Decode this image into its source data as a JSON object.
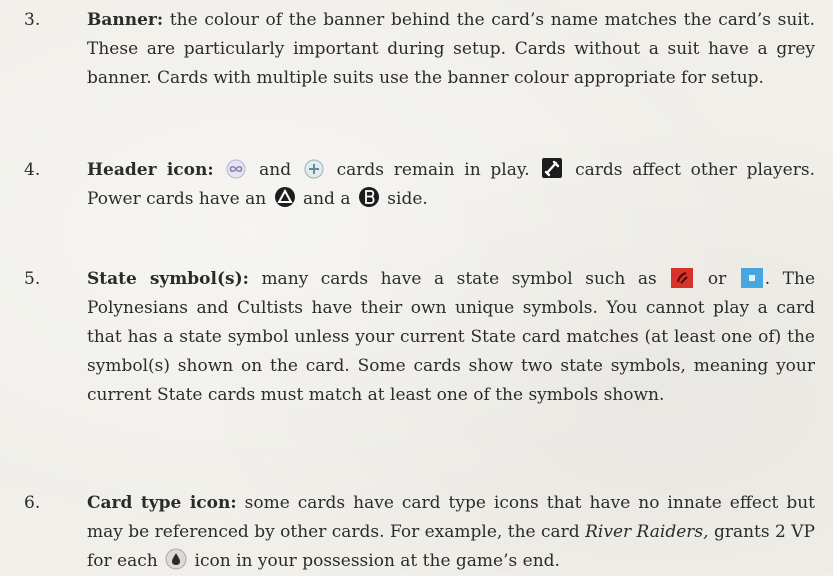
{
  "items": [
    {
      "number": "3.",
      "term": "Banner:",
      "text": "the colour of the banner behind the card’s name matches the card’s suit. These are particularly important during setup. Cards without a suit have a grey banner. Cards with multiple suits use the banner colour appropriate for setup."
    },
    {
      "number": "4.",
      "term": "Header icon:",
      "seg1": "and",
      "seg2": "cards remain in play.",
      "seg3": "cards affect other players. Power cards have an",
      "seg4": "and a",
      "seg5": "side.",
      "icons": [
        "infinity-icon",
        "plus-circle-icon",
        "attack-icon",
        "power-a-icon",
        "power-b-icon"
      ]
    },
    {
      "number": "5.",
      "term": "State symbol(s):",
      "seg1": "many cards have a state symbol such as",
      "seg2": "or",
      "seg3": ". The Polynesians and Cultists have their own unique symbols. You cannot play a card that has a state symbol unless your current State card matches (at least one of) the symbol(s) shown on the card. Some cards show two state symbols, meaning your current State cards must match at least one of the symbols shown.",
      "icons": [
        "red-state-icon",
        "blue-state-icon"
      ]
    },
    {
      "number": "6.",
      "term": "Card type icon:",
      "seg1": "some cards have card type icons that have no innate effect but may be referenced by other cards. For example, the card",
      "card_name": "River Raiders,",
      "seg2": "grants 2 VP for each",
      "seg3": "icon in your possession at the game’s end.",
      "icons": [
        "drop-icon"
      ]
    }
  ],
  "colors": {
    "text": "#2b2b2b",
    "background": "#f1efea",
    "state_red": "#d9322b",
    "state_blue": "#45a6e0"
  }
}
